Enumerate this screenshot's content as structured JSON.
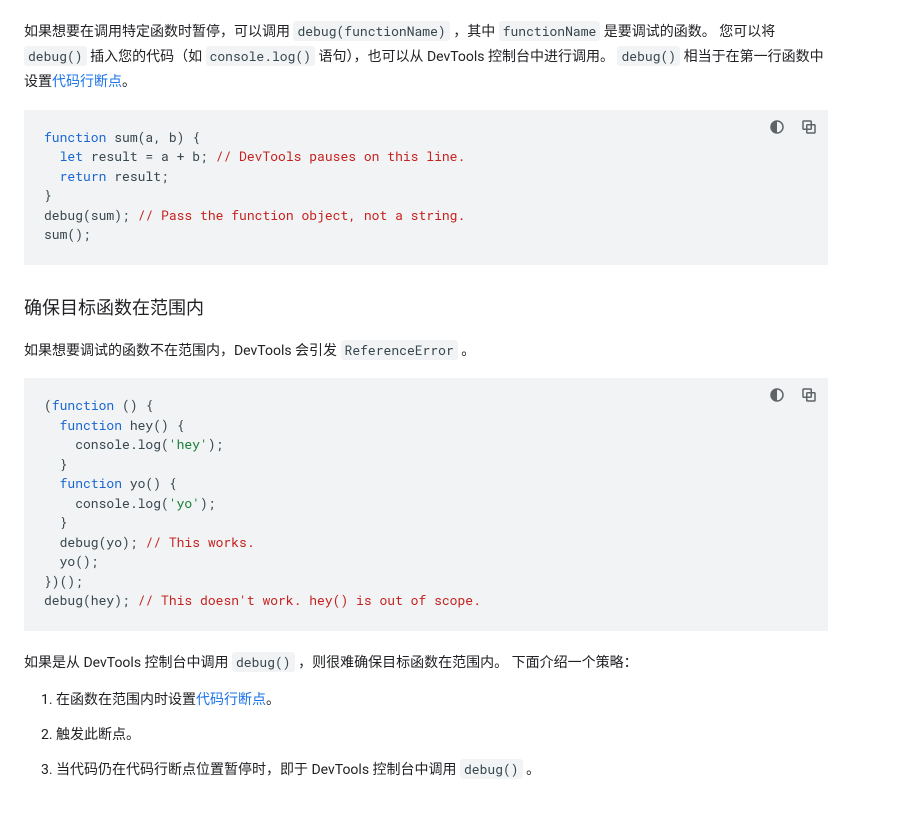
{
  "intro": {
    "t1": "如果想要在调用特定函数时暂停，可以调用 ",
    "c1": "debug(functionName)",
    "t2": " ，其中 ",
    "c2": "functionName",
    "t3": " 是要调试的函数。 您可以将 ",
    "c3": "debug()",
    "t4": " 插入您的代码（如 ",
    "c4": "console.log()",
    "t5": " 语句），也可以从 DevTools 控制台中进行调用。 ",
    "c5": "debug()",
    "t6": " 相当于在第一行函数中设置",
    "link": "代码行断点",
    "t7": "。"
  },
  "code1": {
    "l1a": "function",
    "l1b": " sum(a, b) {",
    "l2a": "  ",
    "l2b": "let",
    "l2c": " result = a + b; ",
    "l2d": "// DevTools pauses on this line.",
    "l3a": "  ",
    "l3b": "return",
    "l3c": " result;",
    "l4": "}",
    "l5a": "debug(sum); ",
    "l5b": "// Pass the function object, not a string.",
    "l6": "sum();"
  },
  "section_heading": "确保目标函数在范围内",
  "scope_para": {
    "t1": "如果想要调试的函数不在范围内，DevTools 会引发 ",
    "c1": "ReferenceError",
    "t2": " 。"
  },
  "code2": {
    "l1a": "(",
    "l1b": "function",
    "l1c": " () {",
    "l2a": "  ",
    "l2b": "function",
    "l2c": " hey() {",
    "l3a": "    console.log(",
    "l3b": "'hey'",
    "l3c": ");",
    "l4": "  }",
    "l5a": "  ",
    "l5b": "function",
    "l5c": " yo() {",
    "l6a": "    console.log(",
    "l6b": "'yo'",
    "l6c": ");",
    "l7": "  }",
    "l8a": "  debug(yo); ",
    "l8b": "// This works.",
    "l9": "  yo();",
    "l10": "})();",
    "l11a": "debug(hey); ",
    "l11b": "// This doesn't work. hey() is out of scope."
  },
  "closing": {
    "t1": "如果是从 DevTools 控制台中调用 ",
    "c1": "debug()",
    "t2": " ，则很难确保目标函数在范围内。 下面介绍一个策略："
  },
  "steps": {
    "s1a": "在函数在范围内时设置",
    "s1link": "代码行断点",
    "s1b": "。",
    "s2": "触发此断点。",
    "s3a": "当代码仍在代码行断点位置暂停时，即于 DevTools 控制台中调用 ",
    "s3c": "debug()",
    "s3b": " 。"
  }
}
